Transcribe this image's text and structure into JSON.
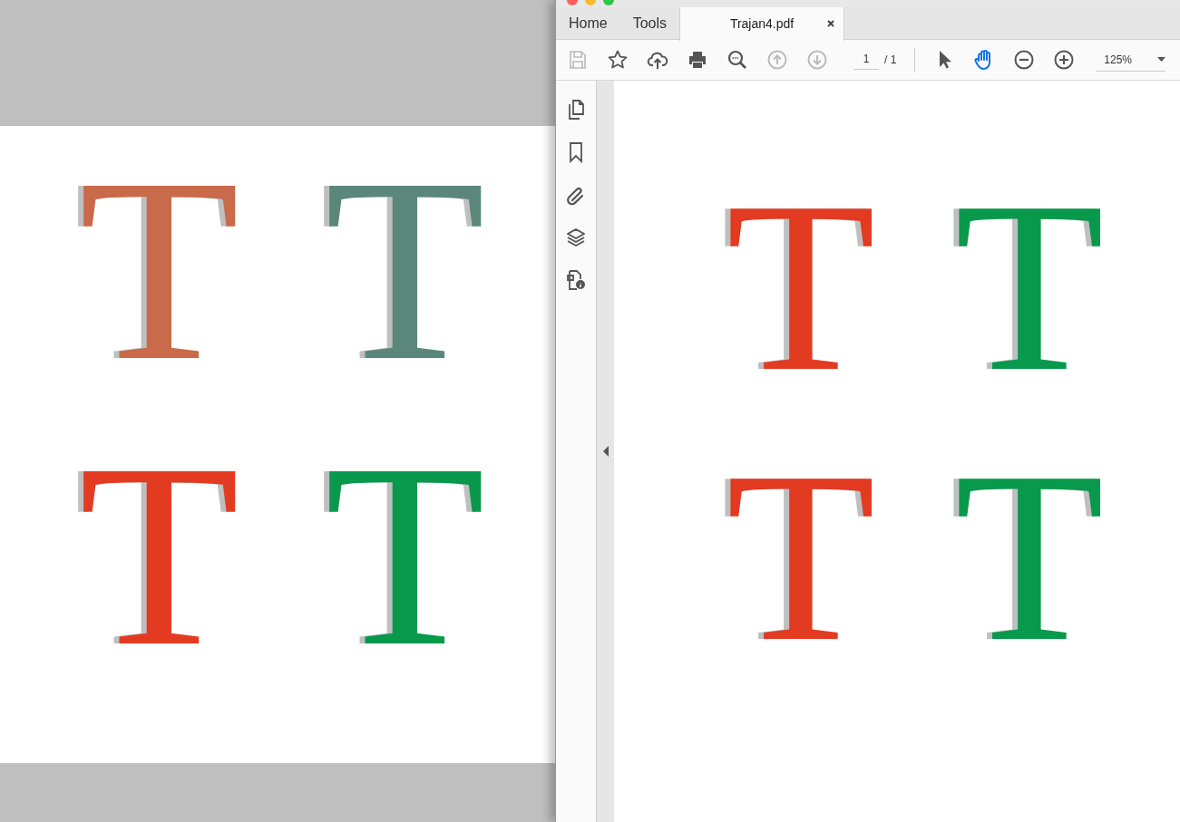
{
  "background_document": {
    "letters": [
      {
        "text": "T",
        "color": "#c96a4a"
      },
      {
        "text": "T",
        "color": "#5a877a"
      },
      {
        "text": "T",
        "color": "#e23b22"
      },
      {
        "text": "T",
        "color": "#08994c"
      }
    ]
  },
  "tabs": [
    {
      "label": "Home",
      "selected": false
    },
    {
      "label": "Tools",
      "selected": false
    },
    {
      "label": "Trajan4.pdf",
      "selected": true
    }
  ],
  "toolbar": {
    "tools": [
      {
        "kind": "save",
        "disabled": true,
        "selected": false
      },
      {
        "kind": "star",
        "disabled": false,
        "selected": false
      },
      {
        "kind": "upload",
        "disabled": false,
        "selected": false
      },
      {
        "kind": "print",
        "disabled": false,
        "selected": false
      },
      {
        "kind": "zoom-search",
        "disabled": false,
        "selected": false
      },
      {
        "kind": "page-up",
        "disabled": true,
        "selected": false
      },
      {
        "kind": "page-down",
        "disabled": true,
        "selected": false
      }
    ],
    "page_number": "1",
    "page_total": "/ 1",
    "nav_tools": [
      {
        "kind": "pointer",
        "disabled": false,
        "selected": false
      },
      {
        "kind": "hand",
        "disabled": false,
        "selected": true
      },
      {
        "kind": "zoom-out",
        "disabled": false,
        "selected": false
      },
      {
        "kind": "zoom-in",
        "disabled": false,
        "selected": false
      }
    ],
    "zoom": "125%"
  },
  "sidebar": {
    "items": [
      {
        "kind": "pages"
      },
      {
        "kind": "bookmark"
      },
      {
        "kind": "attachment"
      },
      {
        "kind": "layers"
      },
      {
        "kind": "security"
      }
    ]
  },
  "document": {
    "letters": [
      {
        "text": "T",
        "color": "#e23b22"
      },
      {
        "text": "T",
        "color": "#08994c"
      },
      {
        "text": "T",
        "color": "#e23b22"
      },
      {
        "text": "T",
        "color": "#08994c"
      }
    ]
  }
}
